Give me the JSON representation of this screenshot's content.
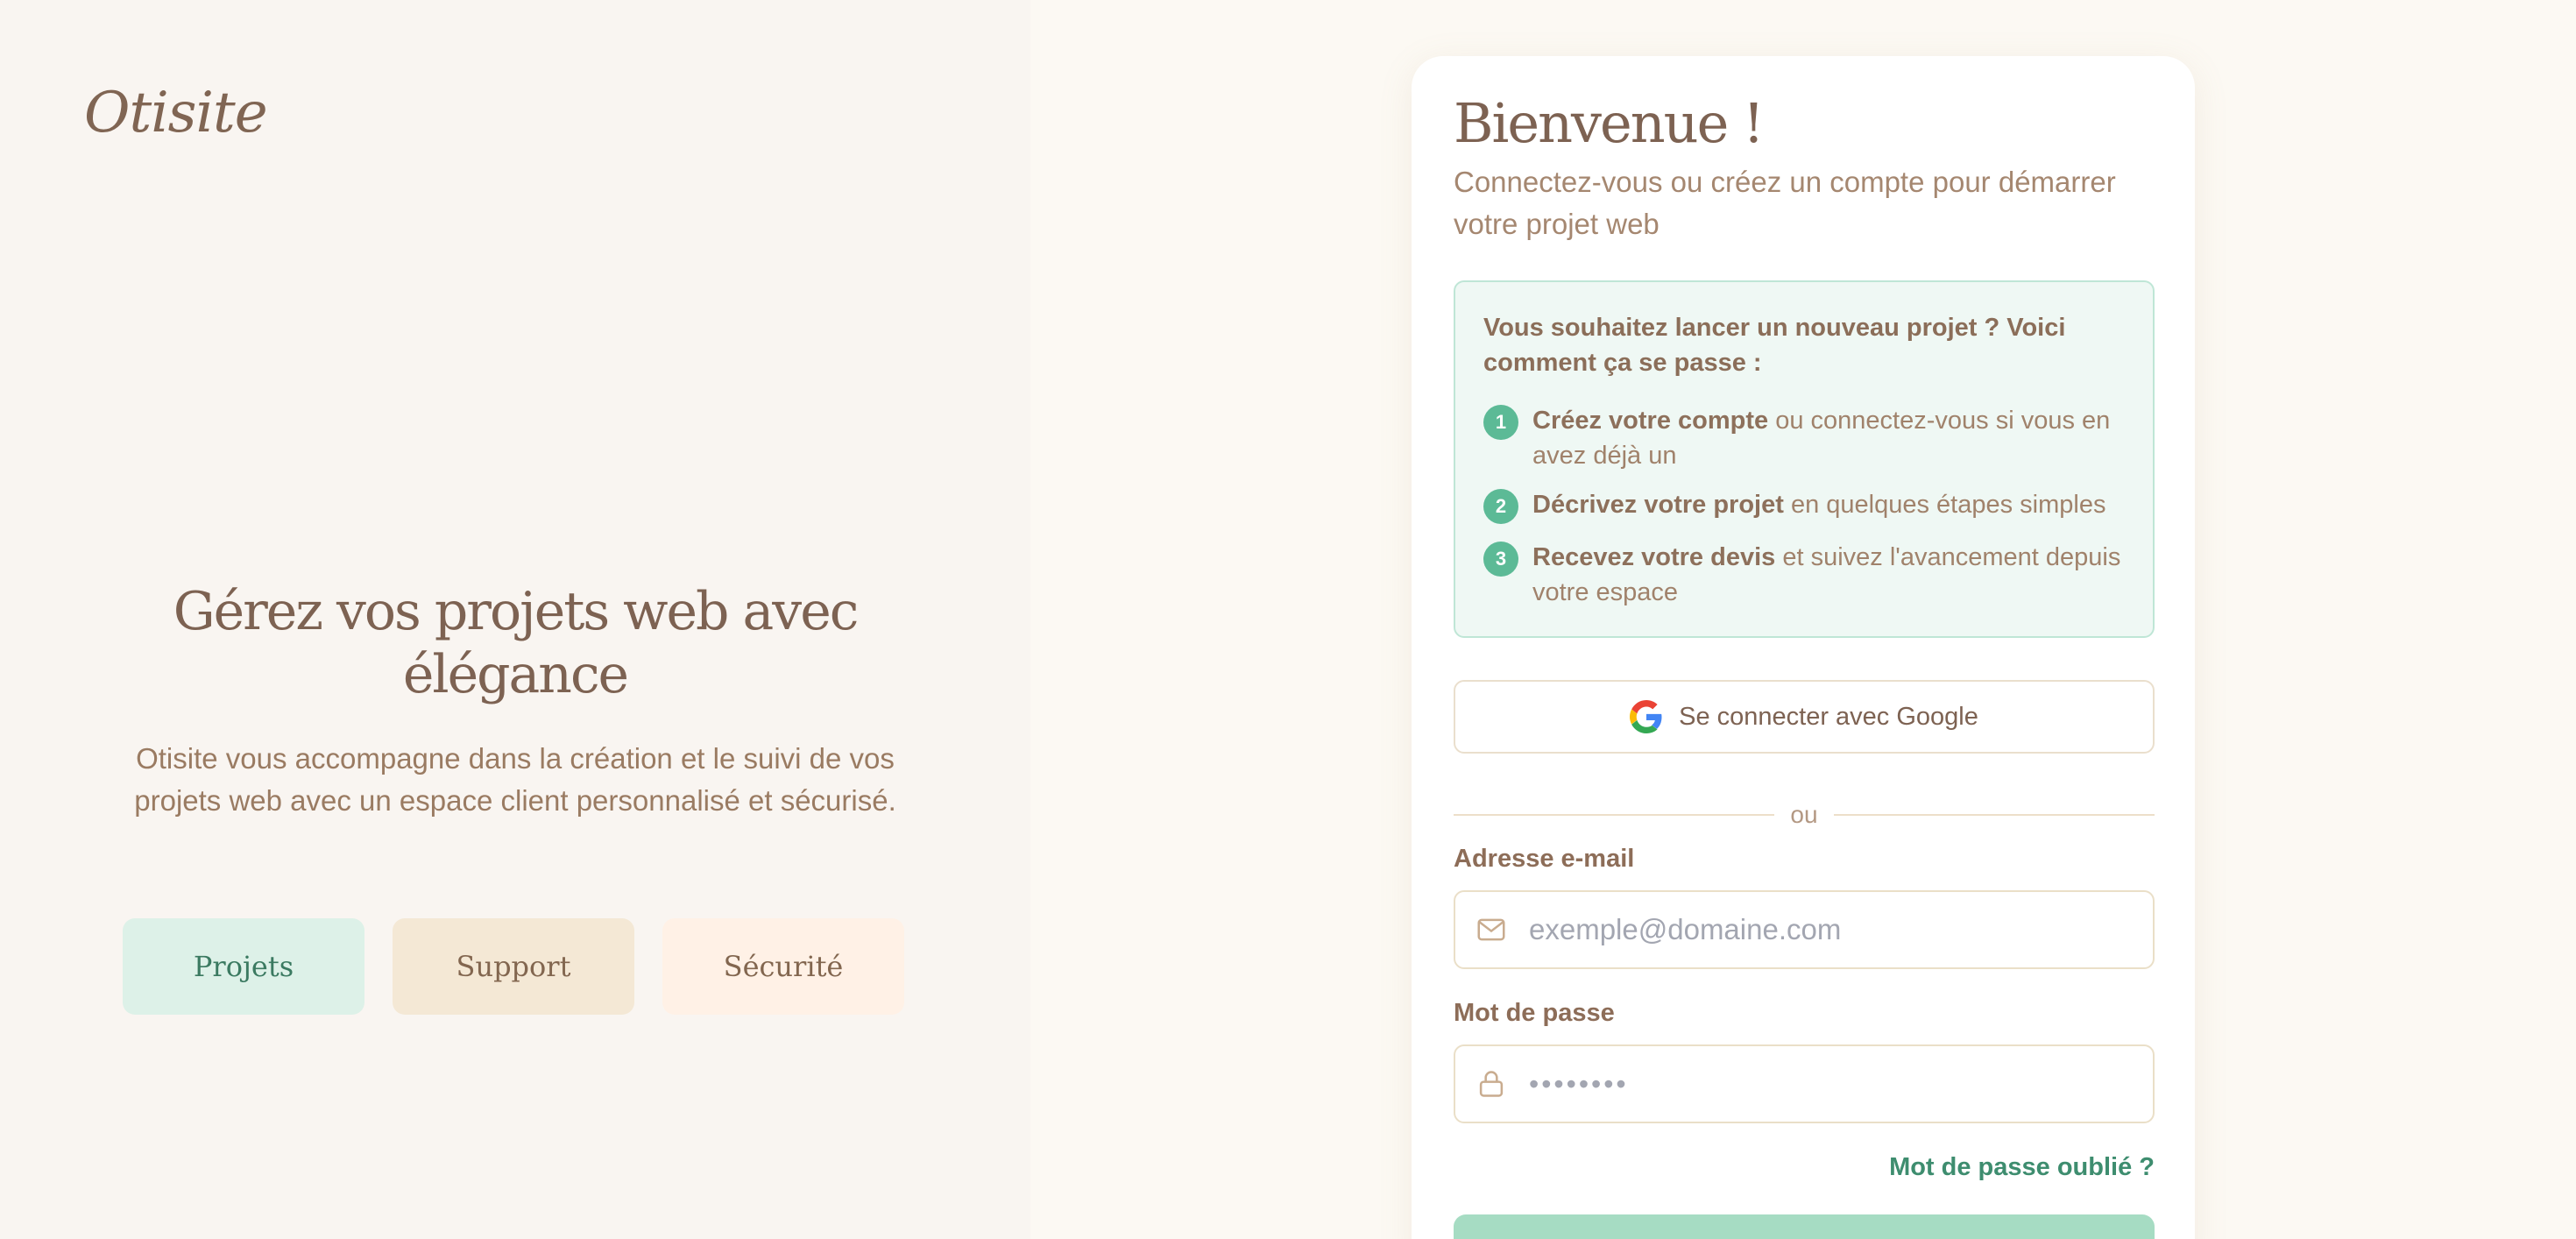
{
  "brand": {
    "logo_text": "Otisite"
  },
  "hero": {
    "title": "Gérez vos projets web avec élégance",
    "description": "Otisite vous accompagne dans la création et le suivi de vos projets web avec un espace client personnalisé et sécurisé."
  },
  "features": [
    {
      "label": "Projets",
      "color": "#ddf1e8"
    },
    {
      "label": "Support",
      "color": "#f4e8d5"
    },
    {
      "label": "Sécurité",
      "color": "#fff1e6"
    }
  ],
  "card": {
    "title": "Bienvenue !",
    "subtitle": "Connectez-vous ou créez un compte pour démarrer votre projet web",
    "steps_intro": "Vous souhaitez lancer un nouveau projet ? Voici comment ça se passe :",
    "steps": [
      {
        "number": "1",
        "bold": "Créez votre compte",
        "rest": " ou connectez-vous si vous en avez déjà un"
      },
      {
        "number": "2",
        "bold": "Décrivez votre projet",
        "rest": " en quelques étapes simples"
      },
      {
        "number": "3",
        "bold": "Recevez votre devis",
        "rest": " et suivez l'avancement depuis votre espace"
      }
    ],
    "google_button_label": "Se connecter avec Google",
    "divider_text": "ou",
    "email": {
      "label": "Adresse e-mail",
      "placeholder": "exemple@domaine.com",
      "icon": "mail-icon"
    },
    "password": {
      "label": "Mot de passe",
      "placeholder": "••••••••",
      "icon": "lock-icon"
    },
    "forgot_password_label": "Mot de passe oublié ?"
  },
  "colors": {
    "accent_green": "#5cba96",
    "link_green": "#3e8d6f",
    "text_brown": "#7d6252",
    "background": "#fcf9f3"
  }
}
